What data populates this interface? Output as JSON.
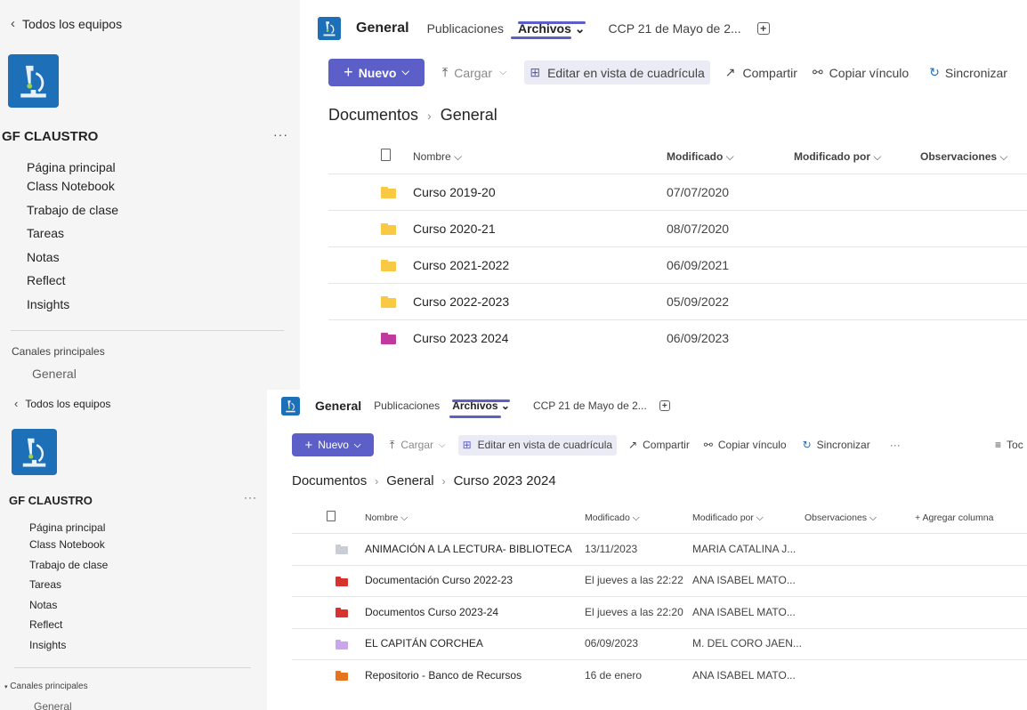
{
  "top": {
    "sidebar": {
      "back_label": "Todos los equipos",
      "team_name": "GF CLAUSTRO",
      "more": "···",
      "nav": [
        "Página principal",
        "Class Notebook",
        "Trabajo de clase",
        "Tareas",
        "Notas",
        "Reflect",
        "Insights"
      ],
      "channels_header": "Canales principales",
      "channel": "General"
    },
    "tabs": {
      "channel_title": "General",
      "items": [
        "Publicaciones",
        "Archivos ⌄",
        "CCP 21 de Mayo de 2..."
      ],
      "add": "+"
    },
    "toolbar": {
      "new": "Nuevo",
      "upload": "Cargar",
      "grid_edit": "Editar en vista de cuadrícula",
      "share": "Compartir",
      "copy_link": "Copiar vínculo",
      "sync": "Sincronizar"
    },
    "breadcrumb": [
      "Documentos",
      "General"
    ],
    "columns": [
      "Nombre",
      "Modificado",
      "Modificado por",
      "Observaciones"
    ],
    "rows": [
      {
        "name": "Curso 2019-20",
        "modified": "07/07/2020",
        "color": "#f9c943"
      },
      {
        "name": "Curso 2020-21",
        "modified": "08/07/2020",
        "color": "#f9c943"
      },
      {
        "name": "Curso 2021-2022",
        "modified": "06/09/2021",
        "color": "#f9c943"
      },
      {
        "name": "Curso 2022-2023",
        "modified": "05/09/2022",
        "color": "#f9c943"
      },
      {
        "name": "Curso 2023 2024",
        "modified": "06/09/2023",
        "color": "#c0399f"
      }
    ]
  },
  "bottom": {
    "sidebar": {
      "back_label": "Todos los equipos",
      "team_name": "GF CLAUSTRO",
      "more": "···",
      "nav": [
        "Página principal",
        "Class Notebook",
        "Trabajo de clase",
        "Tareas",
        "Notas",
        "Reflect",
        "Insights"
      ],
      "channels_header": "Canales principales",
      "channel": "General"
    },
    "tabs": {
      "channel_title": "General",
      "items": [
        "Publicaciones",
        "Archivos ⌄",
        "CCP 21 de Mayo de 2..."
      ],
      "add": "+"
    },
    "toolbar": {
      "new": "Nuevo",
      "upload": "Cargar",
      "grid_edit": "Editar en vista de cuadrícula",
      "share": "Compartir",
      "copy_link": "Copiar vínculo",
      "sync": "Sincronizar",
      "more": "···",
      "view": "Toc"
    },
    "breadcrumb": [
      "Documentos",
      "General",
      "Curso 2023 2024"
    ],
    "columns": [
      "Nombre",
      "Modificado",
      "Modificado por",
      "Observaciones",
      "+ Agregar columna"
    ],
    "rows": [
      {
        "name": "ANIMACIÓN A LA LECTURA- BIBLIOTECA",
        "modified": "13/11/2023",
        "by": "MARIA CATALINA J...",
        "color": "#c8ced4"
      },
      {
        "name": "Documentación Curso 2022-23",
        "modified": "El jueves a las 22:22",
        "by": "ANA ISABEL MATO...",
        "color": "#d8322d"
      },
      {
        "name": "Documentos Curso 2023-24",
        "modified": "El jueves a las 22:20",
        "by": "ANA ISABEL MATO...",
        "color": "#d8322d"
      },
      {
        "name": "EL CAPITÁN CORCHEA",
        "modified": "06/09/2023",
        "by": "M. DEL CORO JAEN...",
        "color": "#c9a6ee"
      },
      {
        "name": "Repositorio - Banco de Recursos",
        "modified": "16 de enero",
        "by": "ANA ISABEL MATO...",
        "color": "#e8731f"
      }
    ]
  },
  "colors": {
    "accent": "#5b5fc7",
    "logo_bg": "#1d6fb8",
    "sidebar_bg": "#f5f5f5"
  },
  "icons": [
    "chevron-left-icon",
    "microscope-logo-icon",
    "folder-icon",
    "file-icon",
    "plus-icon",
    "upload-icon",
    "grid-icon",
    "share-icon",
    "link-icon",
    "sync-icon"
  ]
}
